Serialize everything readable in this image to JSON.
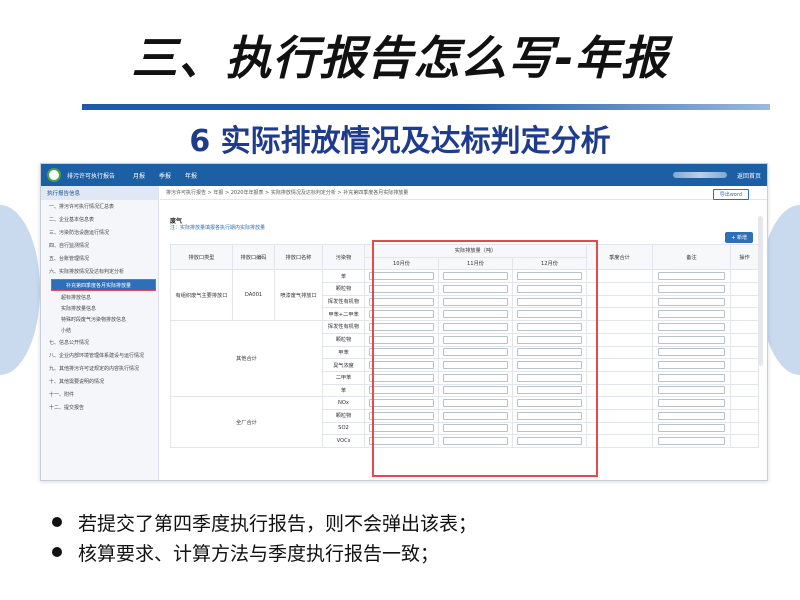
{
  "slide": {
    "title": "三、执行报告怎么写-年报",
    "subtitle": "6 实际排放情况及达标判定分析",
    "bullets": [
      "若提交了第四季度执行报告，则不会弹出该表；",
      "核算要求、计算方法与季度执行报告一致；"
    ]
  },
  "app": {
    "name": "排污许可执行报告",
    "nav": [
      "月报",
      "季报",
      "年报"
    ],
    "back": "返回首页",
    "colors": {
      "header": "#1d5fa4",
      "highlight": "#e24b4b",
      "accent": "#2f6fb8"
    }
  },
  "sidebar": {
    "header": "执行报告信息",
    "items": [
      "一、排污许可执行情况汇总表",
      "二、企业基本信息表",
      "三、污染防治设施运行情况",
      "四、自行监测情况",
      "五、台账管理情况",
      "六、实际排放情况及达标判定分析"
    ],
    "active": "补充第四季度各月实际排放量",
    "subitems": [
      "超标排放信息",
      "实际排放量信息",
      "特殊时段废气污染物排放信息",
      "小结"
    ],
    "items_after": [
      "七、信息公开情况",
      "八、企业内部环境管理体系建设与运行情况",
      "九、其他排污许可证规定的内容执行情况",
      "十、其他需要说明的情况",
      "十一、附件",
      "十二、提交报告"
    ]
  },
  "main": {
    "breadcrumb": "排污许可执行报告 > 年报 > 2020年年报表 > 实际排放情况及达标判定分析 > 补充第四季度各月实际排放量",
    "word_button": "导出word",
    "section_title": "废气",
    "note": "注：实际排放量填报各执行期内实际排放量",
    "add_button": "+ 新增",
    "headers": {
      "outlet_type": "排放口类型",
      "outlet_code": "排放口编码",
      "outlet_name": "排放口名称",
      "pollutant": "污染物",
      "actual": "实际排放量（吨）",
      "months": [
        "10月份",
        "11月份",
        "12月份"
      ],
      "quarter_total": "季度合计",
      "remark": "备注",
      "action": "操作"
    },
    "outlet_row": {
      "type": "有组织废气主要排放口",
      "code": "DA001",
      "name": "喷漆废气排放口"
    },
    "outlet_pollutants": [
      "苯",
      "颗粒物",
      "挥发性有机物",
      "甲苯+二甲苯"
    ],
    "other_total_label": "其他合计",
    "other_pollutants": [
      "挥发性有机物",
      "颗粒物",
      "甲苯",
      "臭气浓度",
      "二甲苯",
      "苯"
    ],
    "plant_total_label": "全厂合计",
    "plant_pollutants": [
      "NOx",
      "颗粒物",
      "SO2",
      "VOCs"
    ]
  }
}
